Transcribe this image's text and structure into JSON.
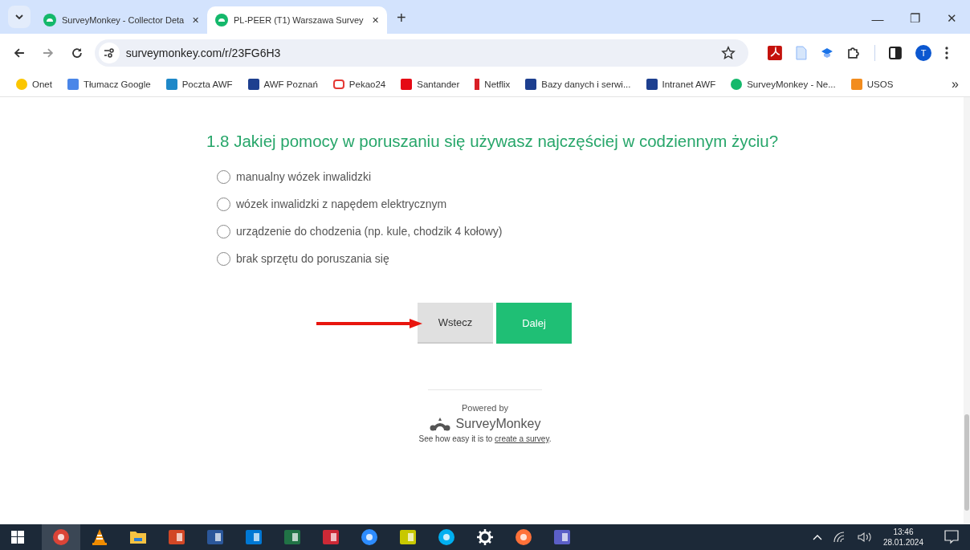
{
  "browser": {
    "tabs": [
      {
        "title": "SurveyMonkey - Collector Deta",
        "close": "✕",
        "selected": false
      },
      {
        "title": "PL-PEER (T1) Warszawa Survey",
        "close": "✕",
        "selected": true
      }
    ],
    "new_tab": "+",
    "window_controls": [
      "—",
      "❐",
      "✕"
    ],
    "url": "surveymonkey.com/r/23FG6H3",
    "profile_initial": "T",
    "bookmarks": [
      {
        "label": "Onet",
        "kind": "dot",
        "color": "#fbc600"
      },
      {
        "label": "Tłumacz Google",
        "kind": "square",
        "color": "#4a86e8"
      },
      {
        "label": "Poczta AWF",
        "kind": "square",
        "color": "#1e88c8"
      },
      {
        "label": "AWF Poznań",
        "kind": "square",
        "color": "#1d3f8f"
      },
      {
        "label": "Pekao24",
        "kind": "outline",
        "color": "#e53935"
      },
      {
        "label": "Santander",
        "kind": "square",
        "color": "#e50914"
      },
      {
        "label": "Netflix",
        "kind": "bar",
        "color": "#d81f26"
      },
      {
        "label": "Bazy danych i serwi...",
        "kind": "square",
        "color": "#1d3f8f"
      },
      {
        "label": "Intranet AWF",
        "kind": "square",
        "color": "#1d3f8f"
      },
      {
        "label": "SurveyMonkey - Ne...",
        "kind": "dot",
        "color": "#14b86b"
      },
      {
        "label": "USOS",
        "kind": "square",
        "color": "#f28c1e"
      }
    ],
    "more_bookmarks": "»"
  },
  "question": {
    "title": "1.8 Jakiej pomocy w poruszaniu się używasz najczęściej w codziennym życiu?",
    "options": [
      {
        "label": "manualny wózek inwalidzki",
        "selected": false
      },
      {
        "label": "wózek inwalidzki z napędem elektrycznym",
        "selected": false
      },
      {
        "label": "urządzenie do chodzenia (np. kule, chodzik 4 kołowy)",
        "selected": false
      },
      {
        "label": "brak sprzętu do poruszania się",
        "selected": false
      }
    ]
  },
  "buttons": [
    {
      "label": "Wstecz",
      "kind": "secondary"
    },
    {
      "label": "Dalej",
      "kind": "primary"
    }
  ],
  "footer": {
    "powered_by": "Powered by",
    "brand": "SurveyMonkey",
    "tagline_before": "See how easy it is to ",
    "link": "create a survey",
    "tagline_after": "."
  },
  "taskbar": {
    "apps": [
      {
        "kind": "chrome",
        "selected": true
      },
      {
        "kind": "vlc",
        "selected": false
      },
      {
        "kind": "files",
        "selected": false
      },
      {
        "kind": "powerpoint",
        "selected": false
      },
      {
        "kind": "word",
        "selected": false
      },
      {
        "kind": "outlook",
        "selected": false
      },
      {
        "kind": "excel",
        "selected": false
      },
      {
        "kind": "zotero",
        "selected": false
      },
      {
        "kind": "zoom",
        "selected": false
      },
      {
        "kind": "notes",
        "selected": false
      },
      {
        "kind": "skype",
        "selected": false
      },
      {
        "kind": "settings",
        "selected": false
      },
      {
        "kind": "firefox",
        "selected": false
      },
      {
        "kind": "teams",
        "selected": false
      }
    ],
    "time": "13:46",
    "date": "28.01.2024"
  }
}
